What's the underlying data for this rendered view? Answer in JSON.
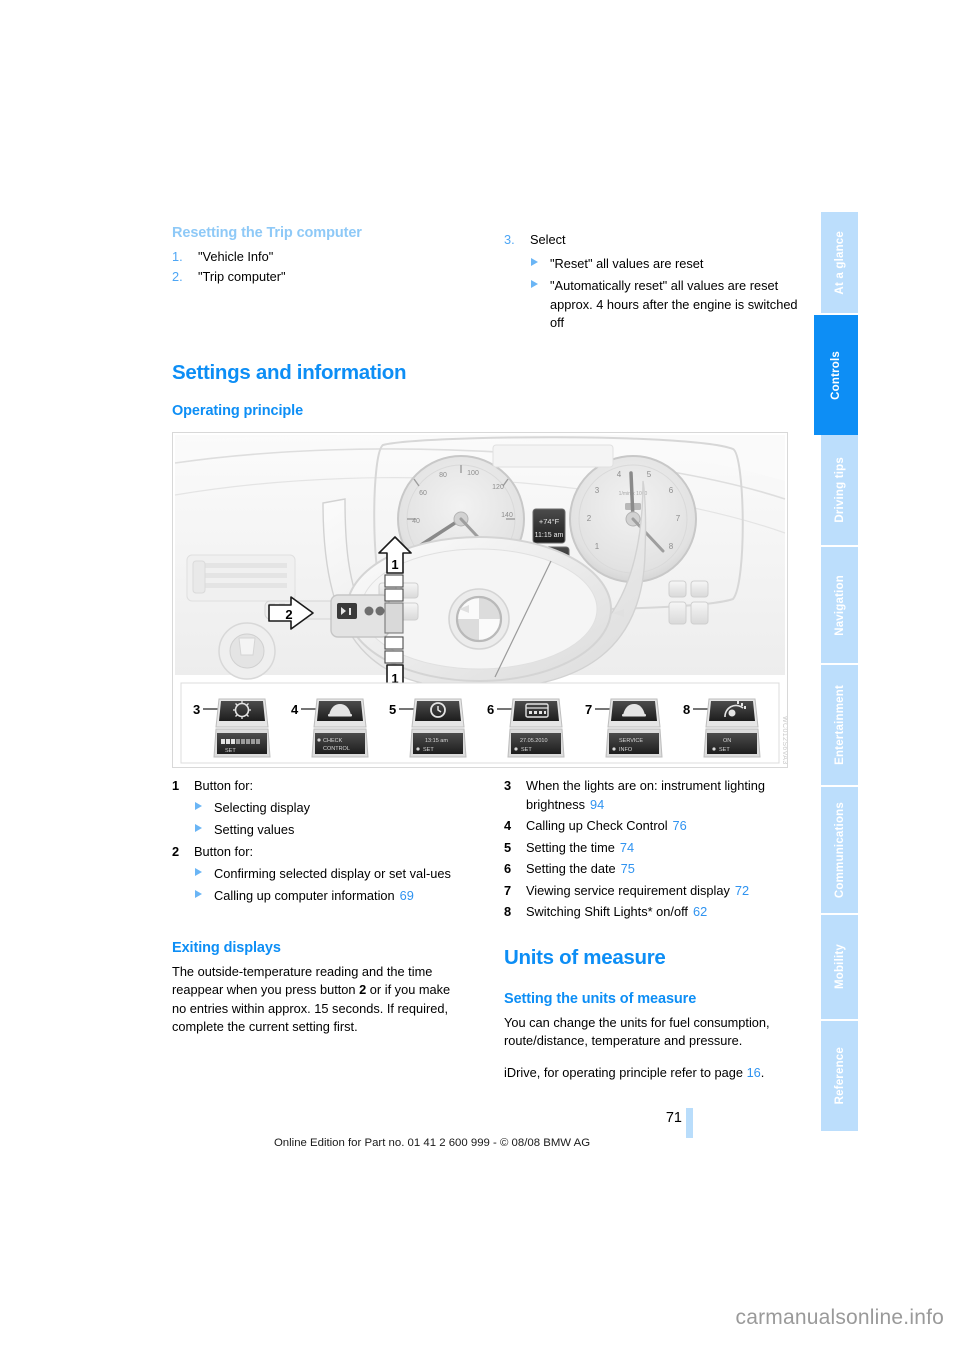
{
  "document": {
    "page_number": "71",
    "footer_line": "Online Edition for Part no. 01 41 2 600 999 - © 08/08 BMW AG",
    "watermark": "carmanualsonline.info"
  },
  "side_tabs": [
    {
      "label": "At a glance",
      "active": false
    },
    {
      "label": "Controls",
      "active": true
    },
    {
      "label": "Driving tips",
      "active": false
    },
    {
      "label": "Navigation",
      "active": false
    },
    {
      "label": "Entertainment",
      "active": false
    },
    {
      "label": "Communications",
      "active": false
    },
    {
      "label": "Mobility",
      "active": false
    },
    {
      "label": "Reference",
      "active": false
    }
  ],
  "left_column": {
    "resetting": {
      "heading": "Resetting the Trip computer",
      "steps": [
        {
          "num": "1.",
          "text": "\"Vehicle Info\""
        },
        {
          "num": "2.",
          "text": "\"Trip computer\""
        }
      ]
    },
    "settings_heading": "Settings and information",
    "operating_principle_heading": "Operating principle",
    "legend": [
      {
        "num": "1",
        "text": "Button for:",
        "subs": [
          {
            "text": "Selecting display",
            "ref": ""
          },
          {
            "text": "Setting values",
            "ref": ""
          }
        ]
      },
      {
        "num": "2",
        "text": "Button for:",
        "subs": [
          {
            "text": "Confirming selected display or set val-ues",
            "ref": ""
          },
          {
            "text": "Calling up computer information",
            "ref": "69"
          }
        ]
      }
    ],
    "exiting": {
      "heading": "Exiting displays",
      "paragraph_a": "The outside-temperature reading and the time reappear when you press button ",
      "paragraph_bold": "2",
      "paragraph_b": " or if you make no entries within approx. 15 seconds. If required, complete the current setting first."
    }
  },
  "right_column": {
    "step3": {
      "num": "3.",
      "text": "Select",
      "subs": [
        {
          "text": "\"Reset\" all values are reset"
        },
        {
          "text": "\"Automatically reset\" all values are reset approx. 4 hours after the engine is switched off"
        }
      ]
    },
    "legend": [
      {
        "num": "3",
        "text": "When the lights are on: instrument lighting brightness",
        "ref": "94"
      },
      {
        "num": "4",
        "text": "Calling up Check Control",
        "ref": "76"
      },
      {
        "num": "5",
        "text": "Setting the time",
        "ref": "74"
      },
      {
        "num": "6",
        "text": "Setting the date",
        "ref": "75"
      },
      {
        "num": "7",
        "text": "Viewing service requirement display",
        "ref": "72"
      },
      {
        "num": "8",
        "text": "Switching Shift Lights* on/off",
        "ref": "62"
      }
    ],
    "units": {
      "heading": "Units of measure",
      "sub_heading": "Setting the units of measure",
      "paragraph1": "You can change the units for fuel consumption, route/distance, temperature and pressure.",
      "paragraph2_a": "iDrive, for operating principle refer to page ",
      "paragraph2_ref": "16",
      "paragraph2_b": "."
    }
  },
  "illustration": {
    "image_code": "WC012S6VA3",
    "callouts": [
      {
        "id": "1",
        "position": "upper-arrow"
      },
      {
        "id": "2",
        "position": "left-arrow"
      },
      {
        "id": "1",
        "position": "lower-arrow"
      }
    ],
    "display_icons": [
      {
        "num": "3",
        "icon": "brightness-sun-icon",
        "screen_text": "SET"
      },
      {
        "num": "4",
        "icon": "car-icon",
        "screen_text": "CHECK CONTROL"
      },
      {
        "num": "5",
        "icon": "clock-icon",
        "screen_text": "13:15 am SET"
      },
      {
        "num": "6",
        "icon": "calendar-icon",
        "screen_text": "27.05.2010 SET"
      },
      {
        "num": "7",
        "icon": "car-service-icon",
        "screen_text": "SERVICE INFO"
      },
      {
        "num": "8",
        "icon": "shift-light-icon",
        "screen_text": "ON SET"
      }
    ],
    "instrument_display": {
      "temperature": "+74°F",
      "time": "11:15 am"
    }
  },
  "colors": {
    "accent_blue": "#0d8ef5",
    "light_blue": "#8ec9f7",
    "tab_blue": "#bcdefc",
    "page_ref_blue": "#2f93f0"
  }
}
